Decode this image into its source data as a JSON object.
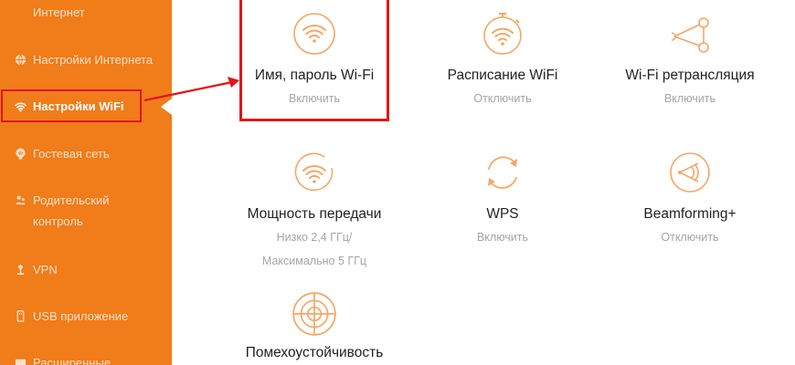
{
  "sidebar": {
    "items": [
      {
        "label": "Интернет",
        "icon": "globe-icon"
      },
      {
        "label": "Настройки Интернета",
        "icon": "globe-icon"
      },
      {
        "label": "Настройки WiFi",
        "icon": "wifi-icon",
        "active": true
      },
      {
        "label": "Гостевая сеть",
        "icon": "guest-icon"
      },
      {
        "label": "Родительский\nконтроль",
        "icon": "parental-icon"
      },
      {
        "label": "VPN",
        "icon": "vpn-icon"
      },
      {
        "label": "USB приложение",
        "icon": "usb-icon"
      },
      {
        "label": "Расширенные",
        "icon": "advanced-icon"
      }
    ]
  },
  "tiles": [
    {
      "title": "Имя, пароль Wi-Fi",
      "status": "Включить",
      "icon": "wifi-icon"
    },
    {
      "title": "Расписание WiFi",
      "status": "Отключить",
      "icon": "wifi-timer-icon"
    },
    {
      "title": "Wi-Fi ретрансляция",
      "status": "Включить",
      "icon": "relay-icon"
    },
    {
      "title": "Мощность передачи",
      "status_line1": "Низко 2,4 ГГц/",
      "status_line2": "Максимально 5 ГГц",
      "icon": "wifi-power-icon"
    },
    {
      "title": "WPS",
      "status": "Включить",
      "icon": "wps-icon"
    },
    {
      "title": "Beamforming+",
      "status": "Отключить",
      "icon": "beamforming-icon"
    },
    {
      "title": "Помехоустойчивость",
      "icon": "interference-icon"
    }
  ],
  "colors": {
    "sidebar_bg": "#f07c1a",
    "accent": "#f5a665",
    "highlight_red": "#e0161b"
  }
}
